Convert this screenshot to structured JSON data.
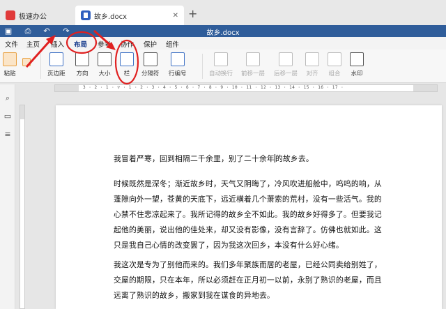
{
  "tabs": [
    {
      "label": "极速办公"
    },
    {
      "label": "故乡.docx"
    }
  ],
  "quickbar": {
    "title": "故乡.docx"
  },
  "menu": [
    "文件",
    "主页",
    "插入",
    "布局",
    "参考",
    "协作",
    "保护",
    "组件"
  ],
  "ribbon": {
    "paste": "粘贴",
    "margin": "页边距",
    "orientation": "方向",
    "size": "大小",
    "columns": "栏",
    "breaks": "分隔符",
    "line_numbers": "行编号",
    "wrap": "自动换行",
    "forward": "前移一层",
    "backward": "后移一层",
    "align": "对齐",
    "group": "组合",
    "watermark": "水印"
  },
  "ruler": {
    "numbers": "3 · 2 · 1 · ▽ · 1 · 2 · 3 · 4 · 5 · 6 · 7 · 8 · 9 · 10 · 11 · 12 · 13 · 14 · 15 · 16 · 17 ·"
  },
  "document": {
    "line1_before": "我冒着严寒，回到相隔二千余里，别了二十余年",
    "line1_after": "的故乡去。",
    "para2": "时候既然是深冬；渐近故乡时，天气又阴晦了，冷风吹进船舱中，呜呜的响，从蓬隙向外一望，苍黄的天底下，远近横着几个萧索的荒村，没有一些活气。我的心禁不住悲凉起来了。我所记得的故乡全不如此。我的故乡好得多了。但要我记起他的美丽，说出他的佳处来，却又没有影像，没有言辞了。仿佛也就如此。这只是我自己心情的改变罢了，因为我这次回乡，本没有什么好心绪。",
    "para3": "我这次是专为了别他而来的。我们多年聚族而居的老屋，已经公同卖给别姓了，交屋的期限，只在本年，所以必须赶在正月初一以前，永别了熟识的老屋，而且远离了熟识的故乡，搬家到我在谋食的异地去。"
  },
  "colors": {
    "accent": "#2f5d9a",
    "annotation": "#e02020"
  }
}
